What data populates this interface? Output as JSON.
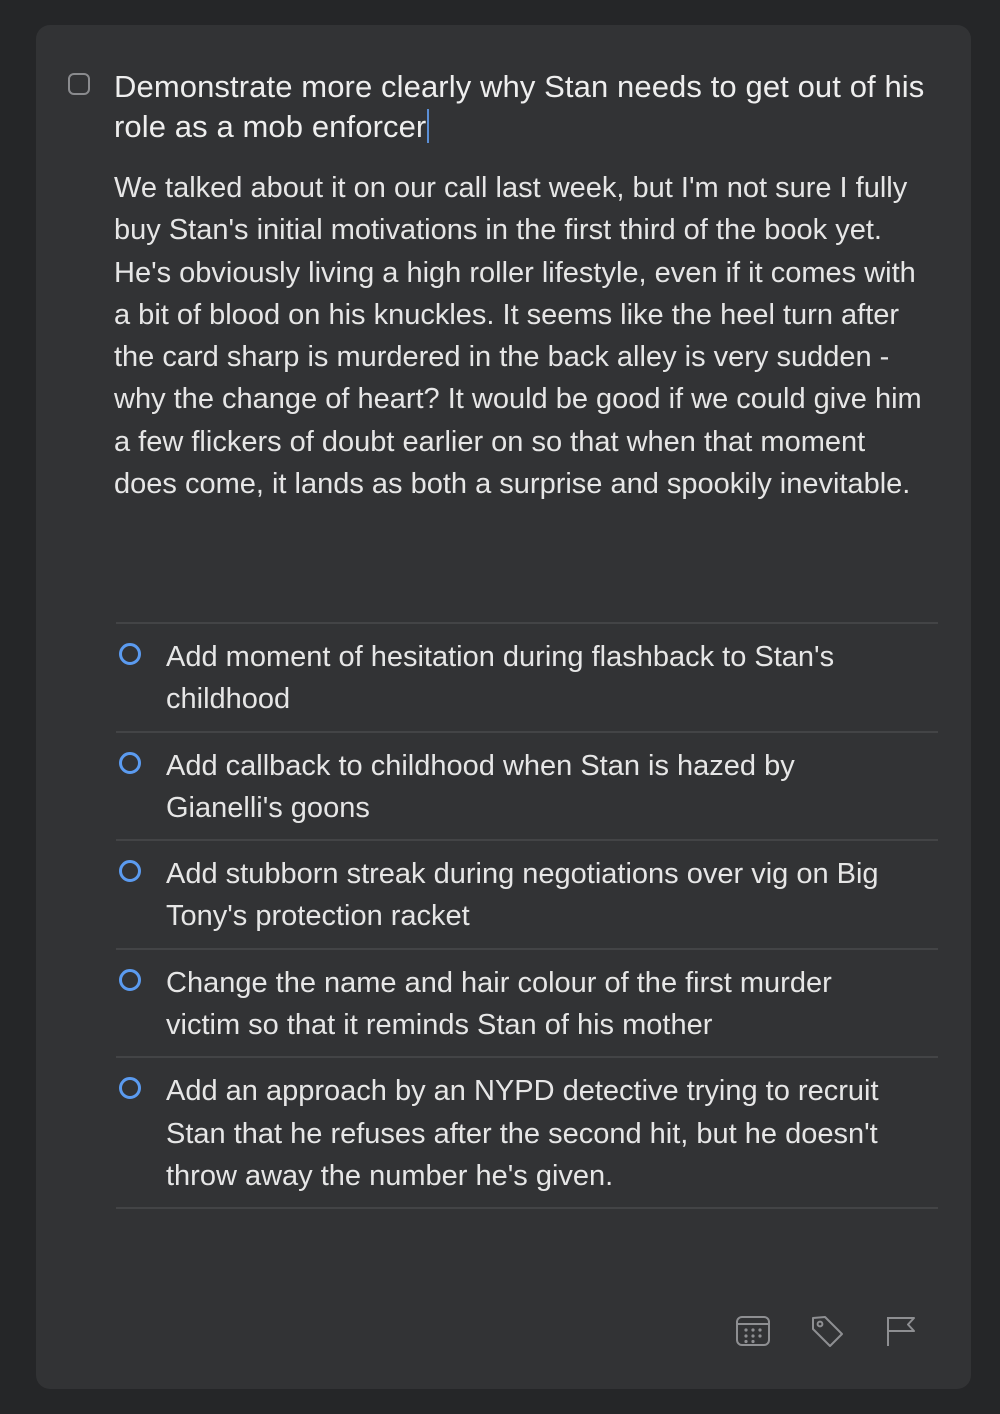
{
  "task": {
    "title": "Demonstrate more clearly why Stan needs to get out of his role as a mob enforcer",
    "notes": "We talked about it on our call last week, but I'm not sure I fully buy Stan's initial motivations in the first third of the book yet. He's obviously living a high roller lifestyle, even if it comes with a bit of blood on his knuckles. It seems like the heel turn after the card sharp is murdered in the back alley is very sudden - why the change of heart? It would be good if we could give him a few flickers of doubt earlier on so that when that moment does come, it lands as both a surprise and spookily inevitable."
  },
  "checklist": [
    {
      "label": "Add moment of hesitation during flashback to Stan's childhood",
      "checked": false
    },
    {
      "label": "Add callback to childhood when Stan is hazed by Gianelli's goons",
      "checked": false
    },
    {
      "label": "Add stubborn streak during negotiations over vig on Big Tony's protection racket",
      "checked": false
    },
    {
      "label": "Change the name and hair colour of the first murder victim so that it reminds Stan of his mother",
      "checked": false
    },
    {
      "label": "Add an approach by an NYPD detective trying to recruit Stan that he refuses after the second hit, but he doesn't throw away the number he's given.",
      "checked": false
    }
  ],
  "toolbar": {
    "icons": [
      "calendar-icon",
      "tag-icon",
      "flag-icon"
    ]
  },
  "colors": {
    "background": "#252628",
    "card": "#323335",
    "text": "#e6e6e6",
    "accent": "#5b9bf0",
    "divider": "#434446"
  }
}
